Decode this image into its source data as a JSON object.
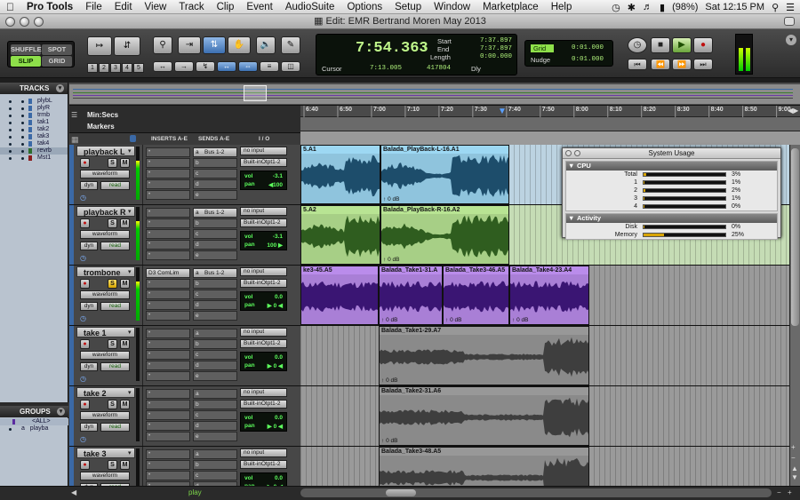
{
  "menubar": {
    "apple": "",
    "items": [
      "Pro Tools",
      "File",
      "Edit",
      "View",
      "Track",
      "Clip",
      "Event",
      "AudioSuite",
      "Options",
      "Setup",
      "Window",
      "Marketplace",
      "Help"
    ],
    "battery": "(98%)",
    "clock": "Sat 12:15 PM"
  },
  "window": {
    "title": "Edit: EMR Bertrand Moren May 2013"
  },
  "toolbar": {
    "modes": [
      "SHUFFLE",
      "SPOT",
      "SLIP",
      "GRID"
    ],
    "zoom_presets": [
      "1",
      "2",
      "3",
      "4",
      "5"
    ],
    "main_counter": "7:54.363",
    "cursor_label": "Cursor",
    "cursor_value": "7:13.005",
    "sample_value": "417804",
    "dly": "Dly",
    "start_label": "Start",
    "start_value": "7:37.897",
    "end_label": "End",
    "end_value": "7:37.897",
    "length_label": "Length",
    "length_value": "0:00.000",
    "grid_label": "Grid",
    "grid_value": "0:01.000",
    "nudge_label": "Nudge",
    "nudge_value": "0:01.000"
  },
  "tracks_panel": {
    "title": "TRACKS",
    "items": [
      "plybL",
      "plyR",
      "trmb",
      "tak1",
      "tak2",
      "tak3",
      "tak4",
      "revrb",
      "Mst1"
    ]
  },
  "groups_panel": {
    "title": "GROUPS",
    "items": [
      "<ALL>",
      "playba"
    ],
    "item_prefixes": [
      "",
      "a"
    ]
  },
  "rulers": {
    "timescale_label": "Min:Secs",
    "markers_label": "Markers",
    "ticks": [
      "6:40",
      "6:50",
      "7:00",
      "7:10",
      "7:20",
      "7:30",
      "7:40",
      "7:50",
      "8:00",
      "8:10",
      "8:20",
      "8:30",
      "8:40",
      "8:50",
      "9:00"
    ]
  },
  "columns": {
    "inserts": "INSERTS A-E",
    "sends": "SENDS A-E",
    "io": "I / O"
  },
  "tracks": [
    {
      "name": "playback L",
      "record_enabled": true,
      "solo": false,
      "view": "waveform",
      "automation": "read",
      "dyn": "dyn",
      "insert": "",
      "send": "Bus 1-2",
      "input": "no input",
      "output": "Built-inOtpt1-2",
      "vol": "-3.1",
      "pan": "◀100",
      "clips": [
        {
          "name": "5.A1",
          "db": ""
        },
        {
          "name": "Balada_PlayBack-L-16.A1",
          "db": "0 dB"
        }
      ]
    },
    {
      "name": "playback R",
      "record_enabled": true,
      "solo": false,
      "view": "waveform",
      "automation": "read",
      "dyn": "dyn",
      "insert": "",
      "send": "Bus 1-2",
      "input": "no input",
      "output": "Built-inOtpt1-2",
      "vol": "-3.1",
      "pan": "100 ▶",
      "clips": [
        {
          "name": "5.A2",
          "db": ""
        },
        {
          "name": "Balada_PlayBack-R-16.A2",
          "db": "0 dB"
        }
      ]
    },
    {
      "name": "trombone",
      "record_enabled": true,
      "solo": true,
      "view": "waveform",
      "automation": "read",
      "dyn": "dyn",
      "insert": "D3 ComLim",
      "send": "Bus 1-2",
      "input": "no input",
      "output": "Built-inOtpt1-2",
      "vol": "0.0",
      "pan": "▶ 0 ◀",
      "clips": [
        {
          "name": "ke3-45.A5",
          "db": ""
        },
        {
          "name": "Balada_Take1-31.A",
          "db": "0 dB"
        },
        {
          "name": "Balada_Take3-46.A5",
          "db": "0 dB"
        },
        {
          "name": "Balada_Take4-23.A4",
          "db": "0 dB"
        }
      ]
    },
    {
      "name": "take 1",
      "record_enabled": true,
      "solo": false,
      "view": "waveform",
      "automation": "read",
      "dyn": "dyn",
      "insert": "",
      "send": "",
      "input": "no input",
      "output": "Built-inOtpt1-2",
      "vol": "0.0",
      "pan": "▶ 0 ◀",
      "clips": [
        {
          "name": "Balada_Take1-29.A7",
          "db": "0 dB"
        }
      ]
    },
    {
      "name": "take 2",
      "record_enabled": true,
      "solo": false,
      "view": "waveform",
      "automation": "read",
      "dyn": "dyn",
      "insert": "",
      "send": "",
      "input": "no input",
      "output": "Built-inOtpt1-2",
      "vol": "0.0",
      "pan": "▶ 0 ◀",
      "clips": [
        {
          "name": "Balada_Take2-31.A6",
          "db": "0 dB"
        }
      ]
    },
    {
      "name": "take 3",
      "record_enabled": true,
      "solo": false,
      "view": "waveform",
      "automation": "read",
      "dyn": "dyn",
      "insert": "",
      "send": "",
      "input": "no input",
      "output": "Built-inOtpt1-2",
      "vol": "0.0",
      "pan": "▶ 0 ◀",
      "clips": [
        {
          "name": "Balada_Take3-48.A5",
          "db": ""
        }
      ]
    }
  ],
  "insert_slot_letters": [
    "a",
    "b",
    "c",
    "d",
    "e"
  ],
  "system_usage": {
    "title": "System Usage",
    "cpu_label": "CPU",
    "cpu_rows": [
      {
        "label": "Total",
        "value": "3%",
        "pct": 3
      },
      {
        "label": "1",
        "value": "1%",
        "pct": 1
      },
      {
        "label": "2",
        "value": "2%",
        "pct": 2
      },
      {
        "label": "3",
        "value": "1%",
        "pct": 1
      },
      {
        "label": "4",
        "value": "0%",
        "pct": 0
      }
    ],
    "activity_label": "Activity",
    "activity_rows": [
      {
        "label": "Disk",
        "value": "0%",
        "pct": 0
      },
      {
        "label": "Memory",
        "value": "25%",
        "pct": 25
      }
    ]
  },
  "bottom": {
    "label": "play"
  },
  "colors": {
    "clip_blue": "#8fc4dd",
    "clip_green": "#a7cf86",
    "clip_purple": "#a97fd6",
    "clip_gray": "#8a8a8a",
    "wave_blue": "#1d4d6b",
    "wave_green": "#2f5d1f",
    "wave_purple": "#3a1573",
    "wave_gray": "#3e3e3e"
  }
}
